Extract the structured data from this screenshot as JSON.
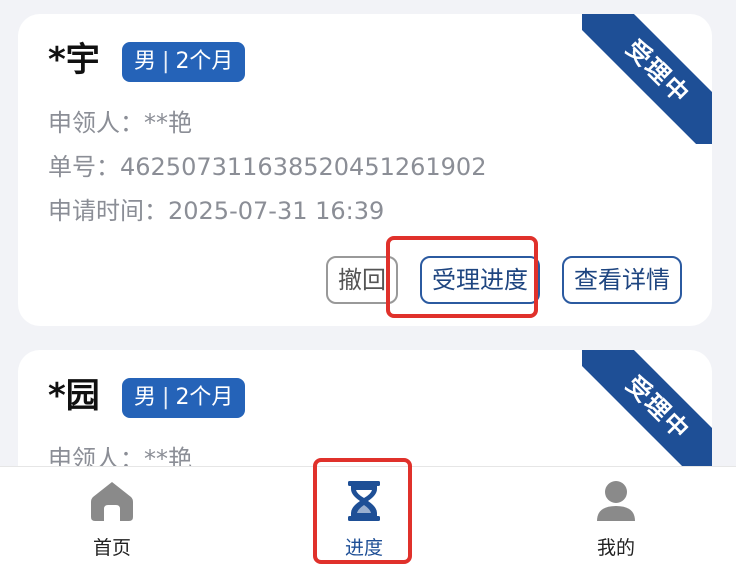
{
  "cards": [
    {
      "name": "*宇",
      "gender": "男",
      "age": "2个月",
      "status": "受理中",
      "applicant_label": "申领人：",
      "applicant": "**艳",
      "order_label": "单号：",
      "order_no": "462507311638520451261902",
      "time_label": "申请时间：",
      "time": "2025-07-31 16:39",
      "actions": {
        "revoke": "撤回",
        "progress": "受理进度",
        "detail": "查看详情"
      }
    },
    {
      "name": "*园",
      "gender": "男",
      "age": "2个月",
      "status": "受理中",
      "applicant_label": "申领人：",
      "applicant": "**艳"
    }
  ],
  "tabbar": {
    "items": [
      {
        "label": "首页",
        "icon": "home-icon"
      },
      {
        "label": "进度",
        "icon": "hourglass-icon"
      },
      {
        "label": "我的",
        "icon": "person-icon"
      }
    ],
    "active_color": "#1e4f96",
    "inactive_icon_color": "#8a8a8a"
  },
  "colors": {
    "tag_bg": "#2563b8",
    "ribbon_bg": "#1e4f96",
    "highlight": "#e0312b"
  }
}
